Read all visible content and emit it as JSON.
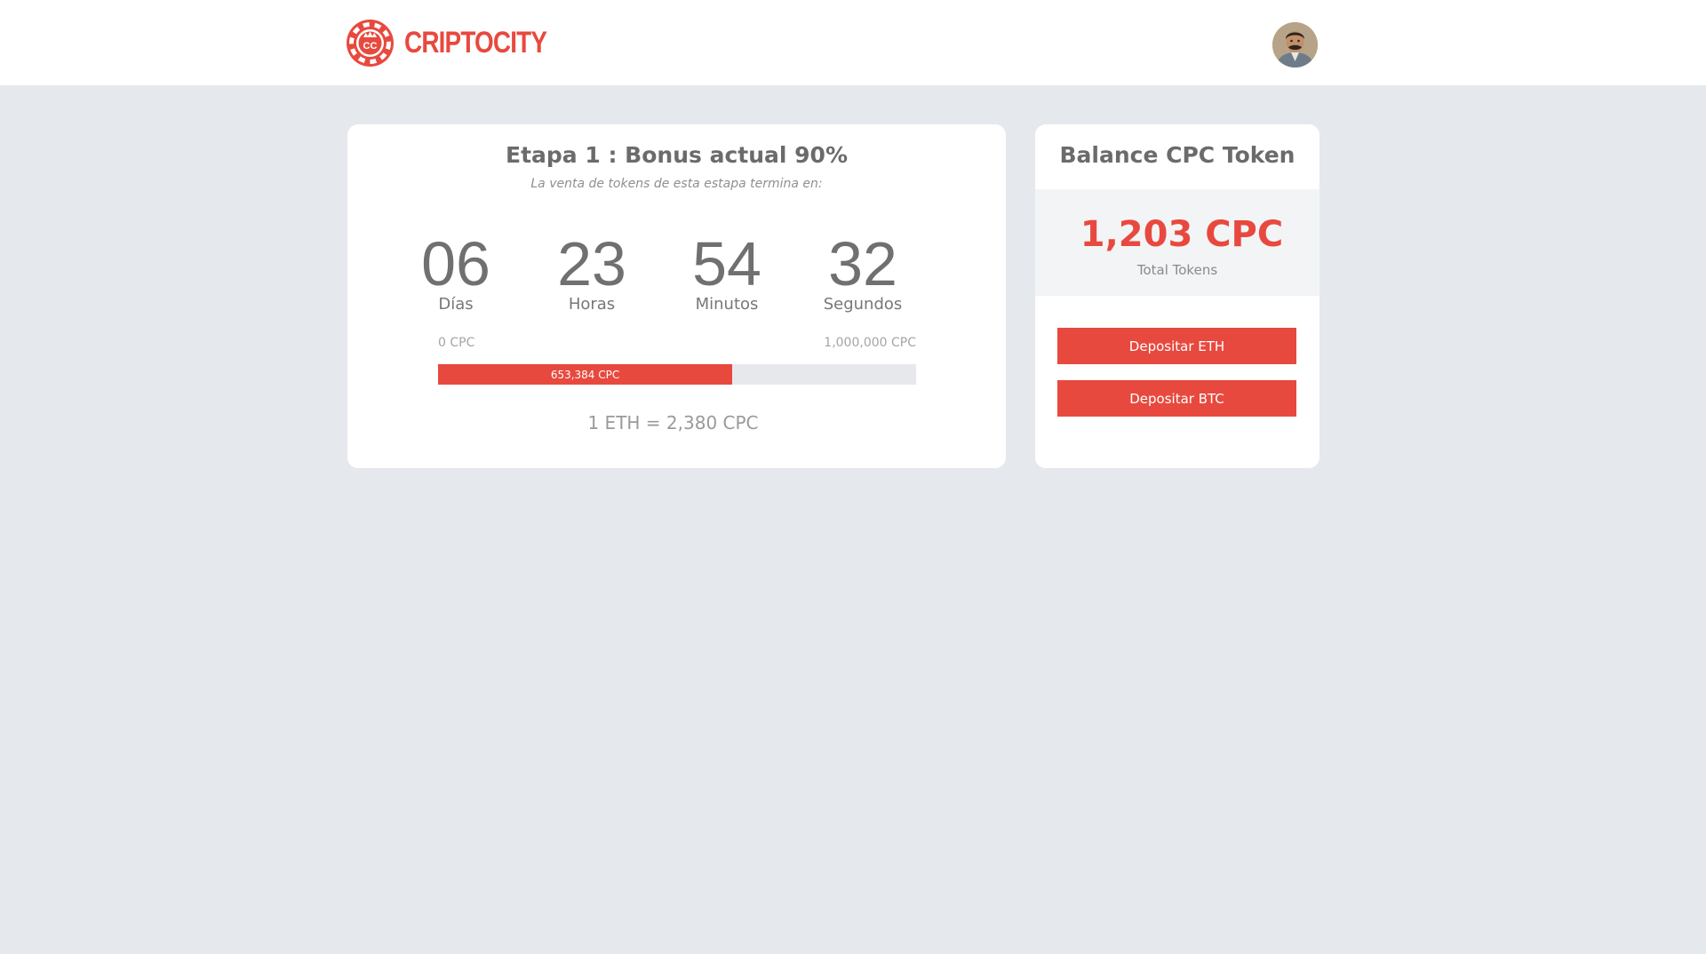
{
  "header": {
    "brand_name": "CRIPTOCITY",
    "logo_monogram": "CC",
    "logo_icon": "poker-chip-crown-icon",
    "avatar_icon": "user-avatar-icon"
  },
  "stage": {
    "title": "Etapa 1 : Bonus actual 90%",
    "subtitle": "La venta de tokens de esta estapa termina en:",
    "countdown": [
      {
        "value": "06",
        "label": "Días"
      },
      {
        "value": "23",
        "label": "Horas"
      },
      {
        "value": "54",
        "label": "Minutos"
      },
      {
        "value": "32",
        "label": "Segundos"
      }
    ],
    "progress": {
      "min_label": "0 CPC",
      "max_label": "1,000,000 CPC",
      "current_label": "653,384 CPC",
      "fraction": 0.6154
    },
    "rate": "1 ETH = 2,380 CPC"
  },
  "balance": {
    "title": "Balance CPC Token",
    "amount": "1,203 CPC",
    "caption": "Total Tokens",
    "deposit_eth_label": "Depositar ETH",
    "deposit_btc_label": "Depositar BTC"
  },
  "colors": {
    "accent": "#e8493e",
    "background": "#e5e8ed",
    "card": "#ffffff",
    "panel": "#f3f4f6",
    "track": "#e6e8ec"
  }
}
